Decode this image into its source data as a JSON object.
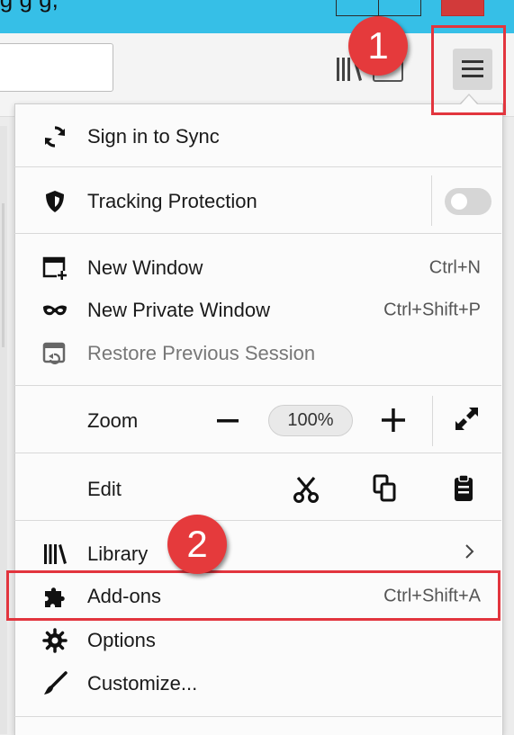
{
  "window": {
    "title_fragment": "ig   g  g,  "
  },
  "annotations": {
    "step1": "1",
    "step2": "2"
  },
  "menu": {
    "sync": {
      "label": "Sign in to Sync",
      "icon": "sync-icon"
    },
    "tracking": {
      "label": "Tracking Protection",
      "icon": "shield-icon",
      "toggle": false
    },
    "new_window": {
      "label": "New Window",
      "shortcut": "Ctrl+N",
      "icon": "new-window-icon"
    },
    "new_private": {
      "label": "New Private Window",
      "shortcut": "Ctrl+Shift+P",
      "icon": "mask-icon"
    },
    "restore": {
      "label": "Restore Previous Session",
      "icon": "restore-session-icon",
      "disabled": true
    },
    "zoom": {
      "label": "Zoom",
      "level": "100%"
    },
    "edit": {
      "label": "Edit"
    },
    "library": {
      "label": "Library",
      "icon": "library-icon"
    },
    "addons": {
      "label": "Add-ons",
      "shortcut": "Ctrl+Shift+A",
      "icon": "puzzle-icon"
    },
    "options": {
      "label": "Options",
      "icon": "gear-icon"
    },
    "customize": {
      "label": "Customize...",
      "icon": "brush-icon"
    }
  },
  "colors": {
    "highlight": "#e2353e",
    "titlebar": "#36bfe7"
  }
}
